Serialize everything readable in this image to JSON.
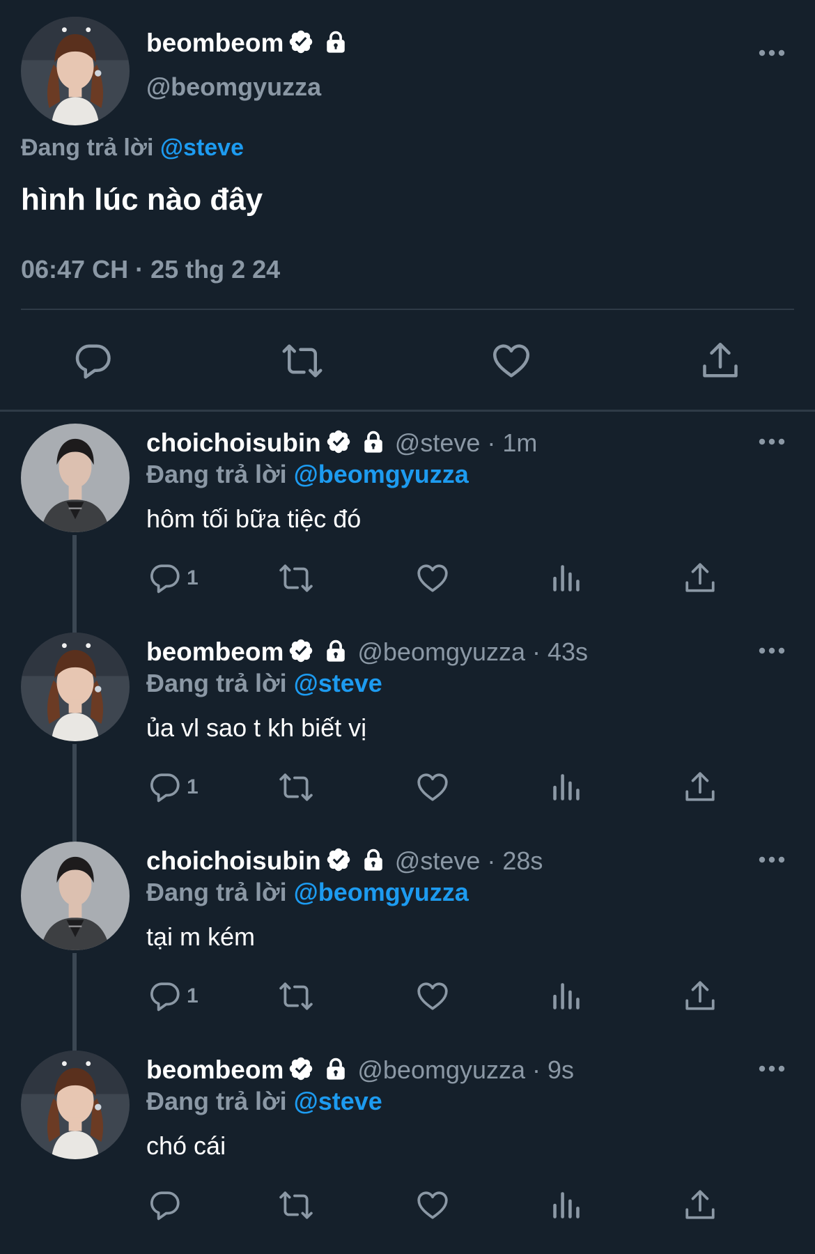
{
  "main_tweet": {
    "display_name": "beombeom",
    "handle": "@beomgyuzza",
    "replying_prefix": "Đang trả lời",
    "replying_to": "@steve",
    "text": "hình lúc nào đây",
    "timestamp": "06:47 CH · 25 thg 2 24"
  },
  "replies": [
    {
      "display_name": "choichoisubin",
      "meta": "@steve · 1m",
      "replying_prefix": "Đang trả lời",
      "replying_to": "@beomgyuzza",
      "text": "hôm tối bữa tiệc đó",
      "reply_count": "1"
    },
    {
      "display_name": "beombeom",
      "meta": "@beomgyuzza · 43s",
      "replying_prefix": "Đang trả lời",
      "replying_to": "@steve",
      "text": "ủa vl sao t kh biết vị",
      "reply_count": "1"
    },
    {
      "display_name": "choichoisubin",
      "meta": "@steve · 28s",
      "replying_prefix": "Đang trả lời",
      "replying_to": "@beomgyuzza",
      "text": "tại m kém",
      "reply_count": "1"
    },
    {
      "display_name": "beombeom",
      "meta": "@beomgyuzza · 9s",
      "replying_prefix": "Đang trả lời",
      "replying_to": "@steve",
      "text": "chó cái",
      "reply_count": ""
    }
  ],
  "colors": {
    "background": "#15202b",
    "accent": "#1d9bf0",
    "secondary_text": "#8b98a5",
    "divider": "#2f3b47"
  },
  "icons": {
    "verified": "verified-badge-icon",
    "protected": "lock-icon",
    "more": "more-dots-icon",
    "reply": "reply-bubble-icon",
    "retweet": "retweet-icon",
    "like": "heart-icon",
    "views": "analytics-bars-icon",
    "share": "share-upload-icon"
  }
}
